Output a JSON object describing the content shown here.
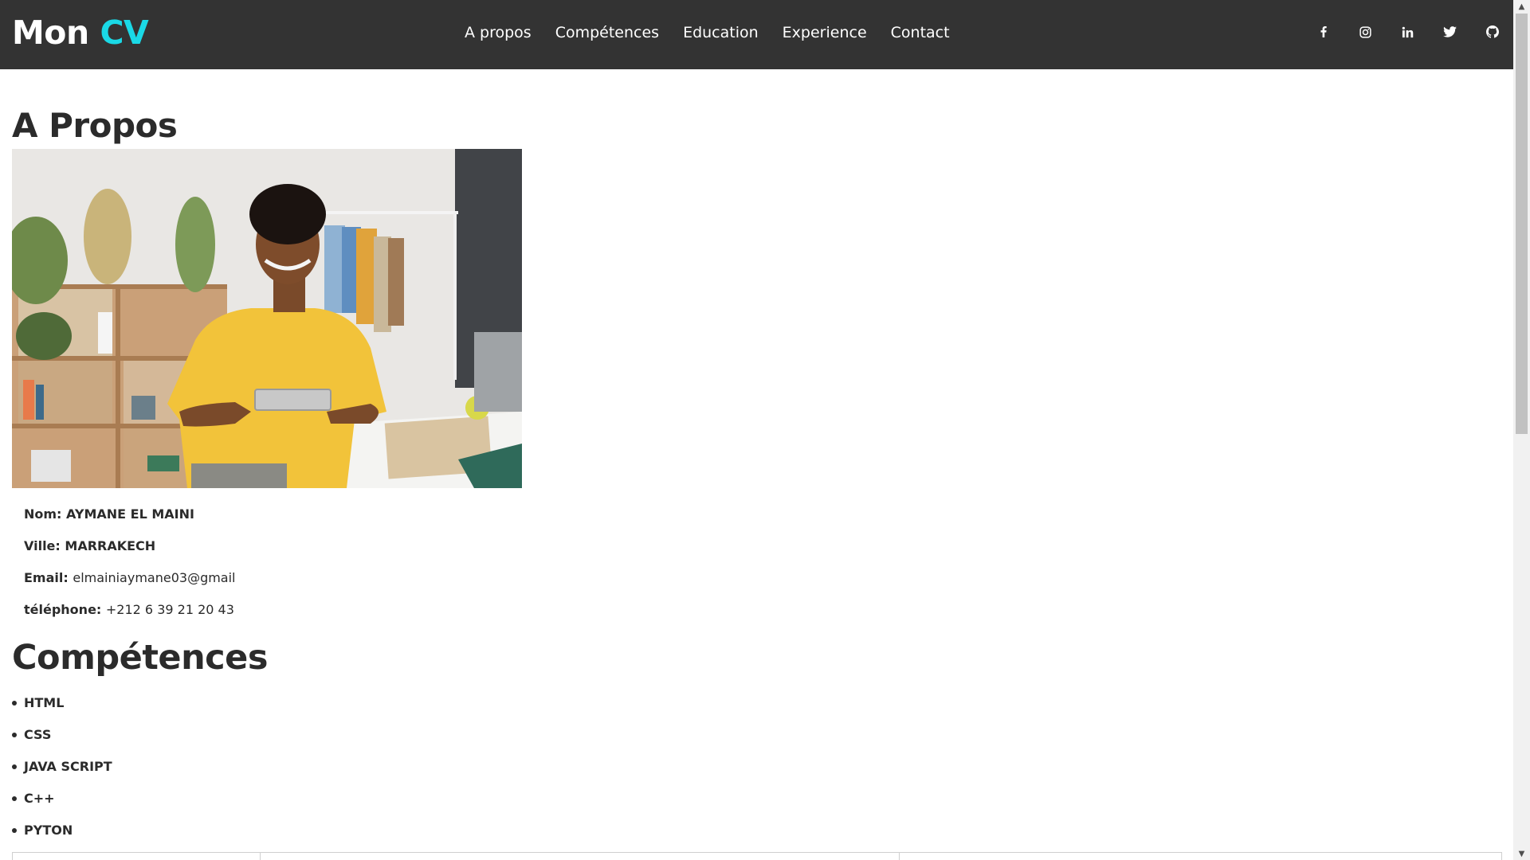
{
  "header": {
    "logo_main": "Mon",
    "logo_accent": "CV",
    "nav": [
      {
        "label": "A propos"
      },
      {
        "label": "Compétences"
      },
      {
        "label": "Education"
      },
      {
        "label": "Experience"
      },
      {
        "label": "Contact"
      }
    ],
    "social": [
      "facebook-icon",
      "instagram-icon",
      "linkedin-icon",
      "twitter-icon",
      "github-icon"
    ],
    "colors": {
      "background": "#333333",
      "accent": "#1ad9e6",
      "text": "#ffffff"
    }
  },
  "about": {
    "title": "A Propos",
    "photo_alt": "smiling young man in yellow t-shirt holding a tablet at a desk",
    "info": [
      {
        "label": "Nom:",
        "value": "AYMANE EL MAINI"
      },
      {
        "label": "Ville:",
        "value": "MARRAKECH"
      },
      {
        "label": "Email:",
        "value": "elmainiaymane03@gmail"
      },
      {
        "label": "téléphone:",
        "value": "+212 6 39 21 20 43"
      }
    ]
  },
  "skills": {
    "title": "Compétences",
    "items": [
      "HTML",
      "CSS",
      "JAVA SCRIPT",
      "C++",
      "PYTON"
    ]
  }
}
